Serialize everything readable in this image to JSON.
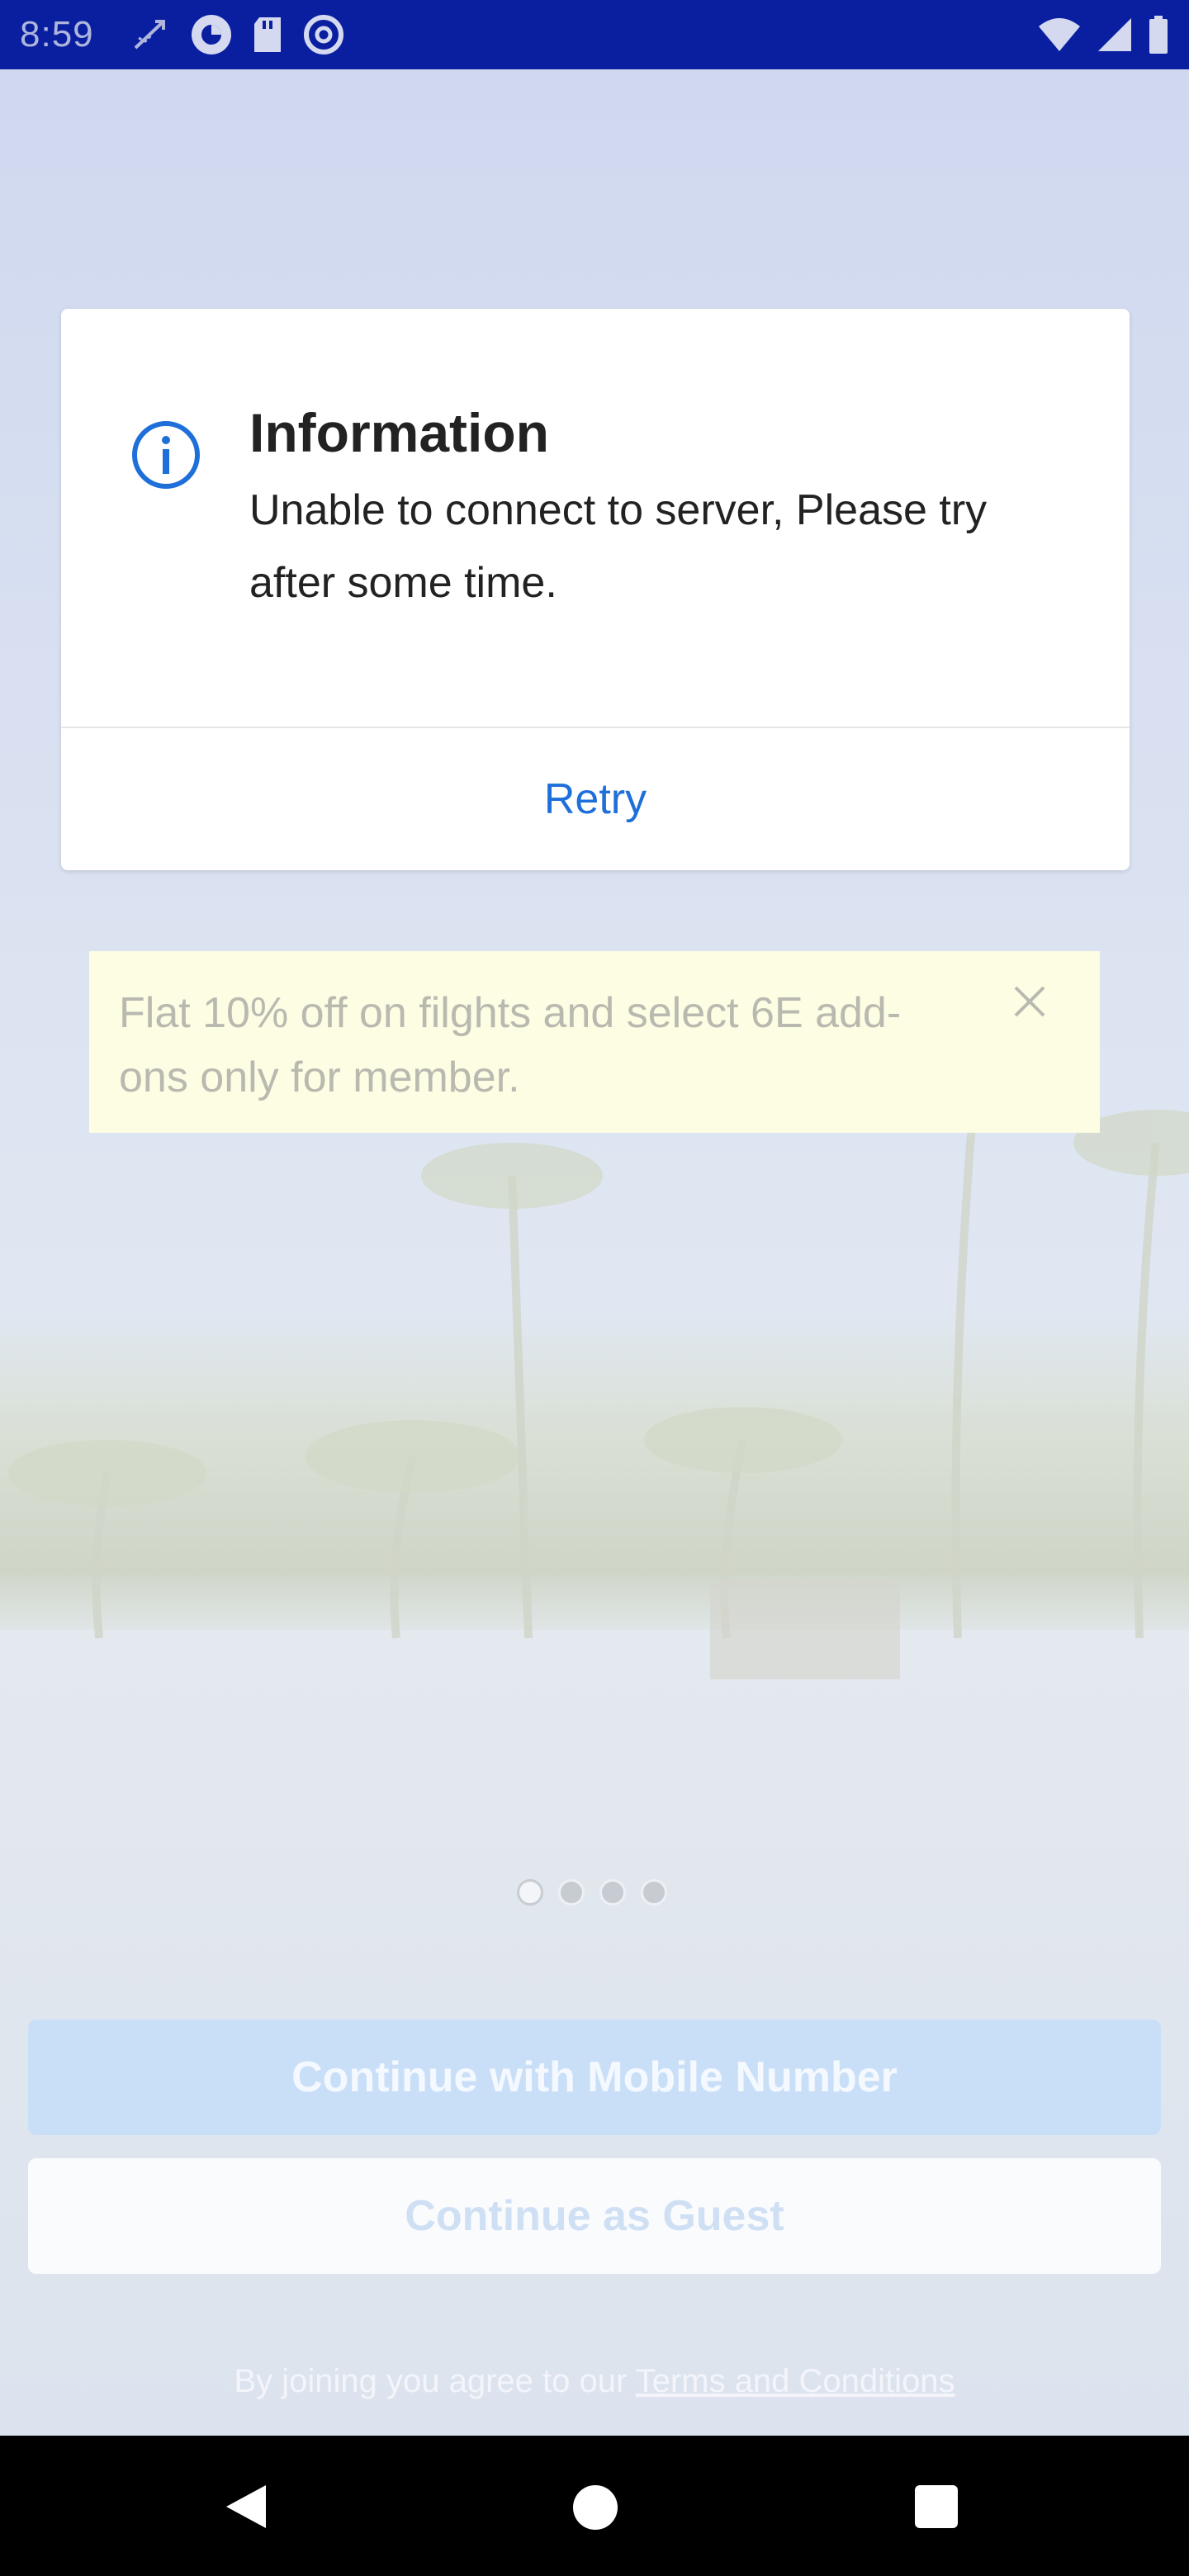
{
  "status_bar": {
    "time": "8:59",
    "left_icons": [
      "missed-call-icon",
      "app-circle-icon",
      "sd-card-icon",
      "at-sign-icon"
    ],
    "right_icons": [
      "wifi-icon",
      "signal-icon",
      "battery-icon"
    ]
  },
  "dialog": {
    "title": "Information",
    "message": "Unable to connect to server, Please try after some time.",
    "retry_label": "Retry",
    "icon": "info-icon",
    "accent_color": "#1e6fd9"
  },
  "promo": {
    "text": "Flat 10% off on filghts and select 6E add-ons only for member.",
    "close_icon": "close-icon"
  },
  "carousel": {
    "dot_count": 4,
    "active_index": 0
  },
  "actions": {
    "mobile_label": "Continue with Mobile Number",
    "guest_label": "Continue as Guest"
  },
  "terms": {
    "prefix": "By joining you agree to our ",
    "link_label": "Terms and Conditions"
  },
  "nav_bar": {
    "icons": [
      "back-icon",
      "home-icon",
      "recents-icon"
    ]
  }
}
